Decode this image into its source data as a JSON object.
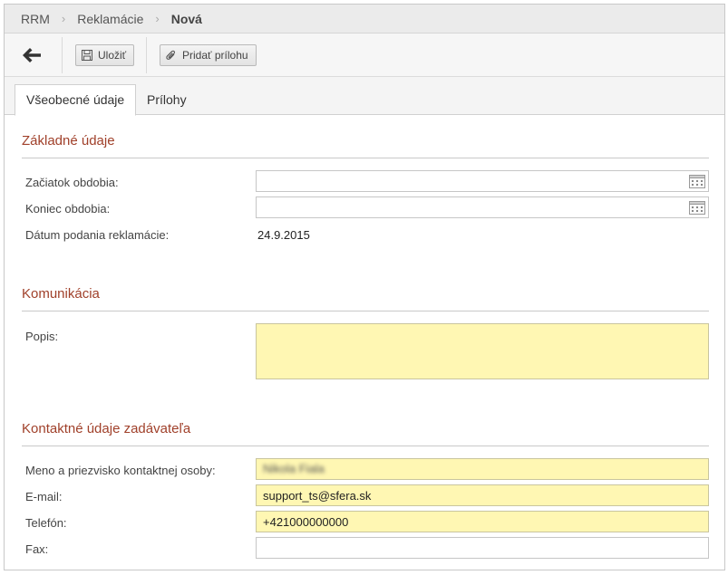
{
  "breadcrumb": {
    "items": [
      "RRM",
      "Reklamácie",
      "Nová"
    ]
  },
  "toolbar": {
    "save_label": "Uložiť",
    "attach_label": "Pridať prílohu"
  },
  "tabs": [
    {
      "label": "Všeobecné údaje",
      "active": true
    },
    {
      "label": "Prílohy",
      "active": false
    }
  ],
  "sections": {
    "basic": {
      "title": "Základné údaje",
      "start_label": "Začiatok obdobia:",
      "start_value": "",
      "end_label": "Koniec obdobia:",
      "end_value": "",
      "filed_label": "Dátum podania reklamácie:",
      "filed_value": "24.9.2015"
    },
    "communication": {
      "title": "Komunikácia",
      "description_label": "Popis:",
      "description_value": ""
    },
    "contact": {
      "title": "Kontaktné údaje zadávateľa",
      "name_label": "Meno a priezvisko kontaktnej osoby:",
      "name_value": "Nikola Fiala",
      "email_label": "E-mail:",
      "email_value": "support_ts@sfera.sk",
      "phone_label": "Telefón:",
      "phone_value": "+421000000000",
      "fax_label": "Fax:",
      "fax_value": ""
    }
  },
  "icons": {
    "back": "arrow-left-icon",
    "save": "floppy-disk-icon",
    "attach": "paperclip-icon",
    "calendar": "calendar-icon"
  },
  "colors": {
    "section_title": "#a0402a",
    "required_field": "#fff7b3"
  }
}
